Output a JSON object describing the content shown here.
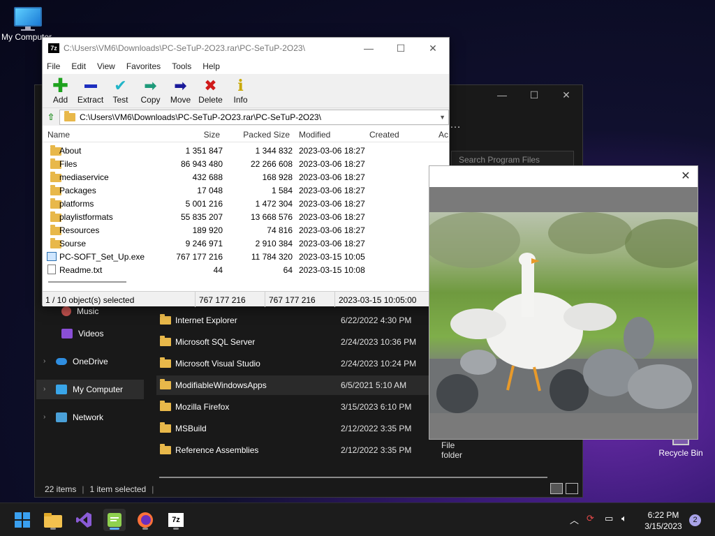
{
  "desktop": {
    "my_computer_label": "My Computer",
    "recycle_bin_label": "Recycle Bin"
  },
  "explorer": {
    "search_placeholder": "Search Program Files",
    "nav": [
      {
        "label": "Music"
      },
      {
        "label": "Videos"
      },
      {
        "label": "OneDrive"
      },
      {
        "label": "My Computer"
      },
      {
        "label": "Network"
      }
    ],
    "files": [
      {
        "name": "Internet Explorer",
        "date": "6/22/2022 4:30 PM",
        "type": ""
      },
      {
        "name": "Microsoft SQL Server",
        "date": "2/24/2023 10:36 PM",
        "type": ""
      },
      {
        "name": "Microsoft Visual Studio",
        "date": "2/24/2023 10:24 PM",
        "type": ""
      },
      {
        "name": "ModifiableWindowsApps",
        "date": "6/5/2021 5:10 AM",
        "type": ""
      },
      {
        "name": "Mozilla Firefox",
        "date": "3/15/2023 6:10 PM",
        "type": ""
      },
      {
        "name": "MSBuild",
        "date": "2/12/2022 3:35 PM",
        "type": ""
      },
      {
        "name": "Reference Assemblies",
        "date": "2/12/2022 3:35 PM",
        "type": "File folder"
      }
    ],
    "status_items": "22 items",
    "status_selected": "1 item selected"
  },
  "zip": {
    "title": "C:\\Users\\VM6\\Downloads\\PC-SeTuP-2O23.rar\\PC-SeTuP-2O23\\",
    "logo": "7z",
    "menu": [
      "File",
      "Edit",
      "View",
      "Favorites",
      "Tools",
      "Help"
    ],
    "toolbar": [
      {
        "label": "Add",
        "icon": "plus-icon",
        "color": "#1ea21e"
      },
      {
        "label": "Extract",
        "icon": "minus-icon",
        "color": "#1e2fbf"
      },
      {
        "label": "Test",
        "icon": "check-icon",
        "color": "#22b5c8"
      },
      {
        "label": "Copy",
        "icon": "arrow-right-icon",
        "color": "#1e9a7a"
      },
      {
        "label": "Move",
        "icon": "arrow-right-icon",
        "color": "#1a1a9a"
      },
      {
        "label": "Delete",
        "icon": "x-icon",
        "color": "#d01a1a"
      },
      {
        "label": "Info",
        "icon": "info-icon",
        "color": "#c8a800"
      }
    ],
    "address": "C:\\Users\\VM6\\Downloads\\PC-SeTuP-2O23.rar\\PC-SeTuP-2O23\\",
    "columns": {
      "name": "Name",
      "size": "Size",
      "packed": "Packed Size",
      "modified": "Modified",
      "created": "Created",
      "accessed": "Ac"
    },
    "rows": [
      {
        "name": "About",
        "size": "1 351 847",
        "packed": "1 344 832",
        "modified": "2023-03-06 18:27",
        "kind": "folder"
      },
      {
        "name": "Files",
        "size": "86 943 480",
        "packed": "22 266 608",
        "modified": "2023-03-06 18:27",
        "kind": "folder"
      },
      {
        "name": "mediaservice",
        "size": "432 688",
        "packed": "168 928",
        "modified": "2023-03-06 18:27",
        "kind": "folder"
      },
      {
        "name": "Packages",
        "size": "17 048",
        "packed": "1 584",
        "modified": "2023-03-06 18:27",
        "kind": "folder"
      },
      {
        "name": "platforms",
        "size": "5 001 216",
        "packed": "1 472 304",
        "modified": "2023-03-06 18:27",
        "kind": "folder"
      },
      {
        "name": "playlistformats",
        "size": "55 835 207",
        "packed": "13 668 576",
        "modified": "2023-03-06 18:27",
        "kind": "folder"
      },
      {
        "name": "Resources",
        "size": "189 920",
        "packed": "74 816",
        "modified": "2023-03-06 18:27",
        "kind": "folder"
      },
      {
        "name": "Sourse",
        "size": "9 246 971",
        "packed": "2 910 384",
        "modified": "2023-03-06 18:27",
        "kind": "folder"
      },
      {
        "name": "PC-SOFT_Set_Up.exe",
        "size": "767 177 216",
        "packed": "11 784 320",
        "modified": "2023-03-15 10:05",
        "kind": "exe"
      },
      {
        "name": "Readme.txt",
        "size": "44",
        "packed": "64",
        "modified": "2023-03-15 10:08",
        "kind": "txt"
      }
    ],
    "status": {
      "selection": "1 / 10 object(s) selected",
      "size": "767 177 216",
      "packed": "767 177 216",
      "modified": "2023-03-15 10:05:00"
    }
  },
  "taskbar": {
    "apps": [
      "windows-start-icon",
      "file-explorer-icon",
      "visual-studio-icon",
      "notepad-app-icon",
      "firefox-icon",
      "7zip-icon"
    ],
    "app_7z_label": "7z",
    "clock_time": "6:22 PM",
    "clock_date": "3/15/2023",
    "notification_count": "2"
  }
}
